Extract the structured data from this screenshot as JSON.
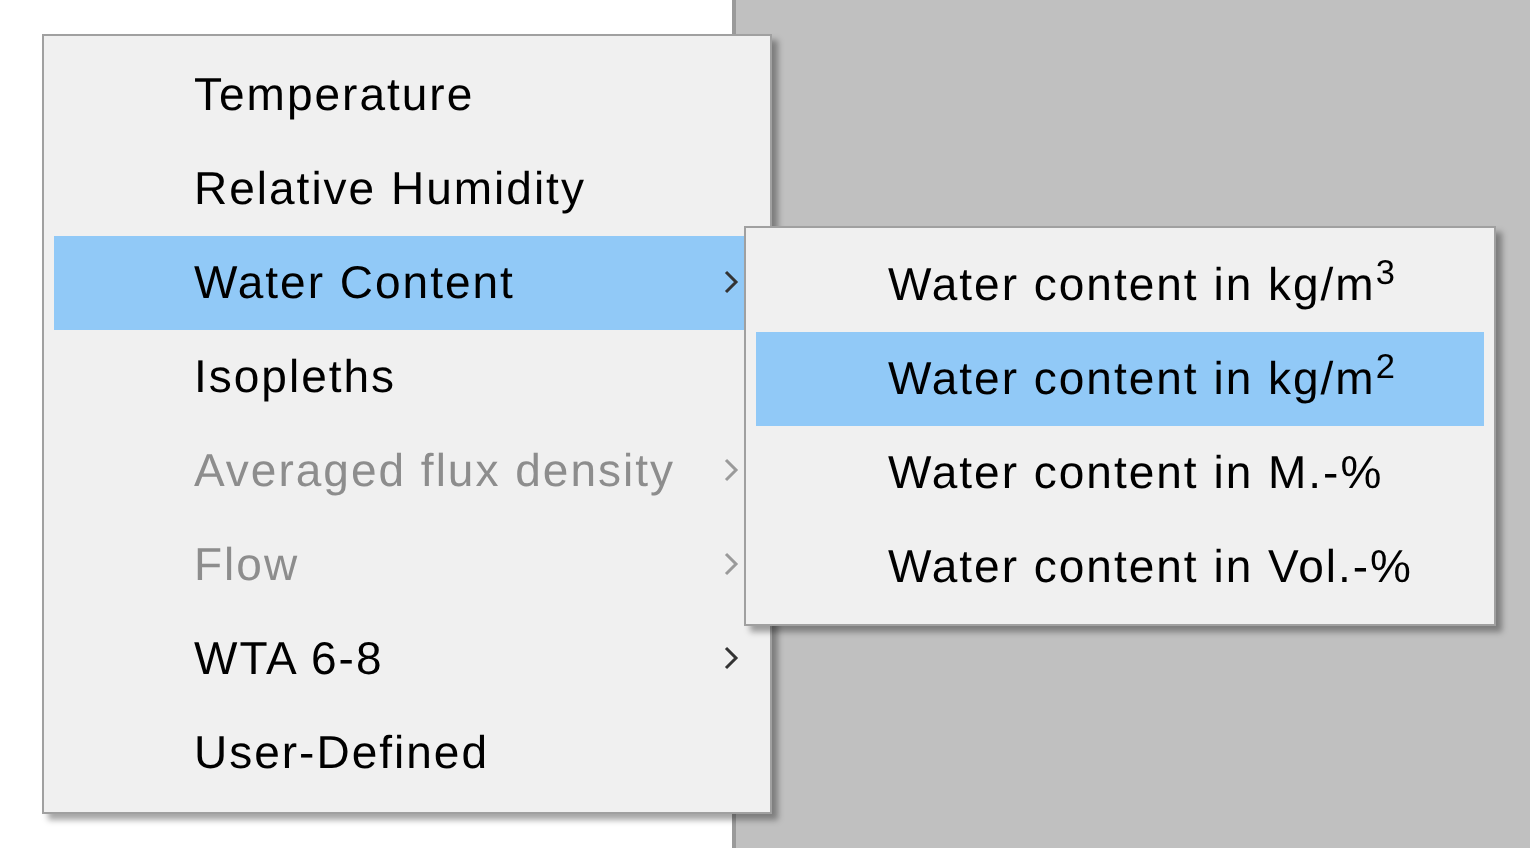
{
  "menu": {
    "items": [
      {
        "label": "Temperature",
        "selected": false,
        "disabled": false,
        "submenu": false
      },
      {
        "label": "Relative Humidity",
        "selected": false,
        "disabled": false,
        "submenu": false
      },
      {
        "label": "Water Content",
        "selected": true,
        "disabled": false,
        "submenu": true
      },
      {
        "label": "Isopleths",
        "selected": false,
        "disabled": false,
        "submenu": false
      },
      {
        "label": "Averaged flux density",
        "selected": false,
        "disabled": true,
        "submenu": true
      },
      {
        "label": "Flow",
        "selected": false,
        "disabled": true,
        "submenu": true
      },
      {
        "label": "WTA 6-8",
        "selected": false,
        "disabled": false,
        "submenu": true
      },
      {
        "label": "User-Defined",
        "selected": false,
        "disabled": false,
        "submenu": false
      }
    ]
  },
  "submenu": {
    "items": [
      {
        "label": "Water content in kg/m$^{3}$",
        "selected": false
      },
      {
        "label": "Water content in kg/m$^{2}$",
        "selected": true
      },
      {
        "label": "Water content in M.-%",
        "selected": false
      },
      {
        "label": "Water content in Vol.-%",
        "selected": false
      }
    ]
  }
}
